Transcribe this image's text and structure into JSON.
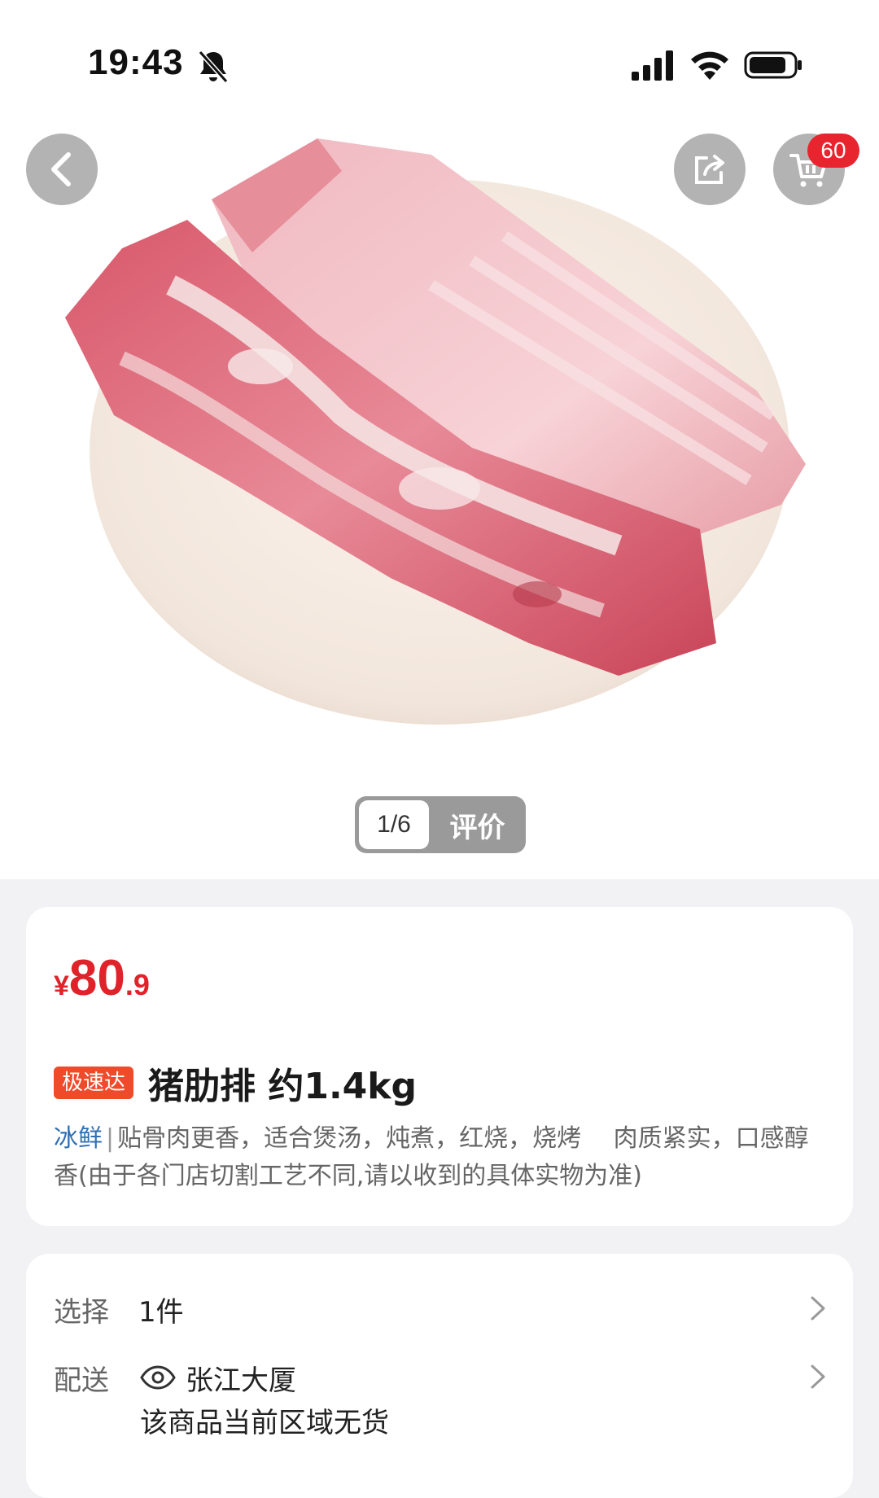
{
  "status_bar": {
    "time": "19:43"
  },
  "header": {
    "cart_count": "60"
  },
  "gallery": {
    "counter": "1/6",
    "review_label": "评价"
  },
  "product": {
    "price_symbol": "¥",
    "price_integer": "80",
    "price_decimal": ".9",
    "tag": "极速达",
    "title": "猪肋排 约1.4kg",
    "attribute": "冰鲜",
    "separator": "|",
    "description": "贴骨肉更香，适合煲汤，炖煮，红烧，烧烤　 肉质紧实，口感醇香(由于各门店切割工艺不同,请以收到的具体实物为准)"
  },
  "delivery": {
    "select_label": "选择",
    "select_value": "1件",
    "ship_label": "配送",
    "address": "张江大厦",
    "stock_note": "该商品当前区域无货"
  },
  "colors": {
    "price_red": "#e0222b",
    "badge_red": "#e8242f",
    "tag_orange": "#ef4a2a",
    "link_blue": "#2f6fb3"
  }
}
